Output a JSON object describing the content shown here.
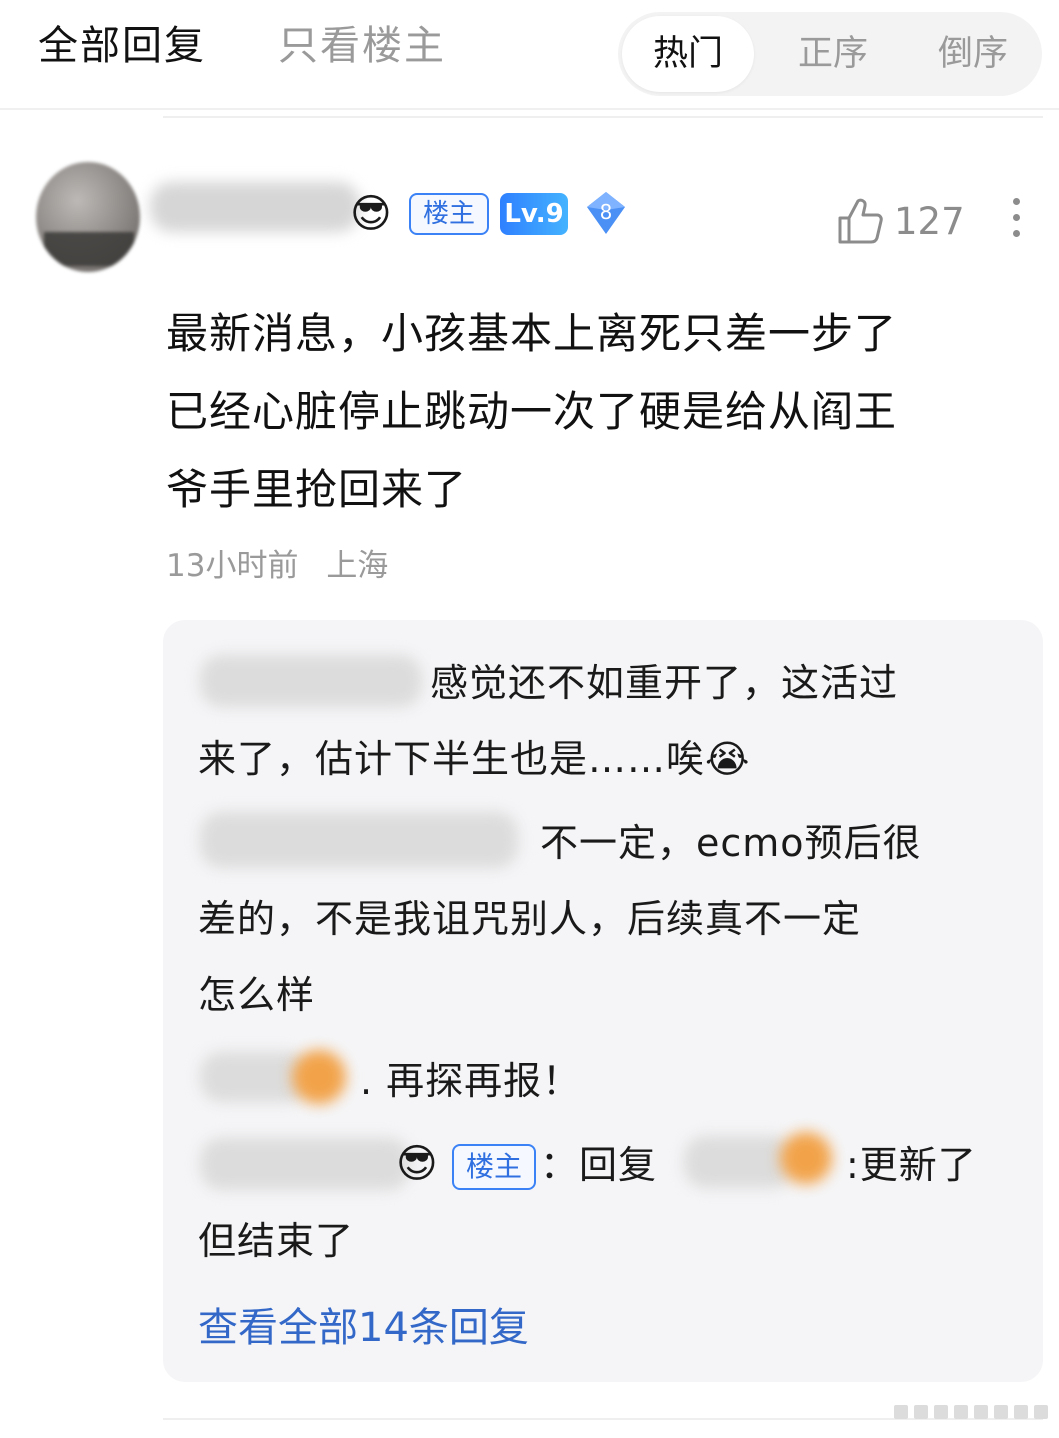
{
  "tabs": {
    "all_replies": "全部回复",
    "op_only": "只看楼主"
  },
  "sort": {
    "hot": "热门",
    "ascending": "正序",
    "descending": "倒序",
    "selected": "热门"
  },
  "post": {
    "badge_op": "楼主",
    "level": "Lv.9",
    "diamond_level": "8",
    "like_count": "127",
    "content": {
      "line1": "最新消息，小孩基本上离死只差一步了",
      "line2": "已经心脏停止跳动一次了硬是给从阎王",
      "line3": "爷手里抢回来了"
    },
    "time": "13小时前",
    "location": "上海"
  },
  "replies": {
    "r1_text": "感觉还不如重开了，这活过",
    "r1_text2": "来了，估计下半生也是……唉",
    "r2_text": "不一定，ecmo预后很",
    "r2_text2": "差的，不是我诅咒别人，后续真不一定",
    "r2_text3": "怎么样",
    "r3_text": "再探再报！",
    "r4_badge": "楼主",
    "r4_prefix": "：回复",
    "r4_text": ":更新了",
    "r4_text2": "但结束了",
    "view_all": "查看全部14条回复"
  },
  "colors": {
    "accent_blue": "#3368c8",
    "badge_blue": "#3b82f6",
    "muted_text": "#9a9a9a",
    "reply_bg": "#f5f5f7"
  },
  "icons": [
    "sunglasses-emoji-icon",
    "thumbs-up-icon",
    "more-vertical-icon",
    "crying-emoji-icon",
    "diamond-badge-icon"
  ]
}
